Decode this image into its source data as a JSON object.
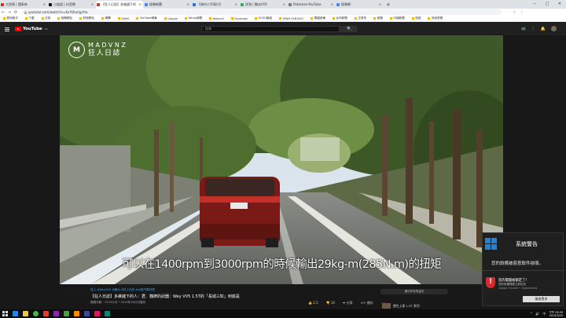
{
  "browser": {
    "tabs": [
      {
        "title": "大陸車 | 懂車帝",
        "active": false
      },
      {
        "title": "小姐姐 | 抖音網",
        "active": false
      },
      {
        "title": "【狂人日誌】多維鏈下的人",
        "active": true
      },
      {
        "title": "搜尋新聞",
        "active": false
      },
      {
        "title": "【海內二手車行】",
        "active": false
      },
      {
        "title": "評測 | 魏派VV5",
        "active": false
      },
      {
        "title": "Pakeman-YouTube",
        "active": false
      },
      {
        "title": "搜尋網",
        "active": false
      }
    ],
    "new_tab": "+",
    "window_controls": [
      "─",
      "□",
      "✕"
    ],
    "url": "youtube.com/watch?v=KvYDtuUgsYw",
    "nav_back": "←",
    "nav_forward": "→",
    "nav_reload": "⟳",
    "addr_icons": [
      "☆",
      "⋮"
    ],
    "bookmarks": [
      "應用程式",
      "下載",
      "交易",
      "相關網站",
      "財經網站",
      "網購",
      "SAMS",
      "YouTube精華",
      "Google",
      "Yahoo新聞",
      "Webcell",
      "Facebook",
      "SOSO論壇",
      "EPAM FANTASY",
      "電腦設備",
      "台灣新聞",
      "交易所",
      "新聞",
      "中國新聞",
      "旅遊",
      "其他書籤"
    ]
  },
  "youtube": {
    "logo_text": "YouTube",
    "region": "TW",
    "search_placeholder": "搜尋",
    "search_icon": "🔍",
    "header_icons": [
      "📹",
      "⋮",
      "🔔"
    ]
  },
  "video": {
    "channel_logo_mark": "M",
    "channel_logo_latin": "MADVNZ",
    "channel_logo_cjk": "狂人日誌",
    "subtitle": "可以在1400rpm到3000rpm的時候輸出29kg-m(285N.m)的扭矩"
  },
  "below_video": {
    "tagline": "狂人 #WeyVV5 #魏派 #狂人日誌 #大陸汽車評測",
    "title": "【狂人日誌】多維鏈下的人：君．魏牌的武器：Wey VV5 1.5T的「長城三缸」到底是",
    "meta": "觀看次數：13,952次 • 2019年3月4日發布",
    "actions": [
      "👍 2,5",
      "👎 14",
      "➦ 分享",
      "≡+ 儲存",
      "⋯"
    ],
    "chip": "顯示所有的留言",
    "next_up": "搶先上車 1.5T 系列"
  },
  "system_warning": {
    "title": "系統警告",
    "message": "您的設備被惡意軟件損壞。",
    "alert_title": "您的電腦被鎖定了！",
    "alert_sub": "您的設備需要立即檢查",
    "alert_source": "Google Chrome + Ingalatvema",
    "button": "檢查更多"
  },
  "taskbar": {
    "time": "下午 03:39",
    "date": "2019/3/20",
    "tray_icons": [
      "^",
      "🔊",
      "中"
    ]
  }
}
